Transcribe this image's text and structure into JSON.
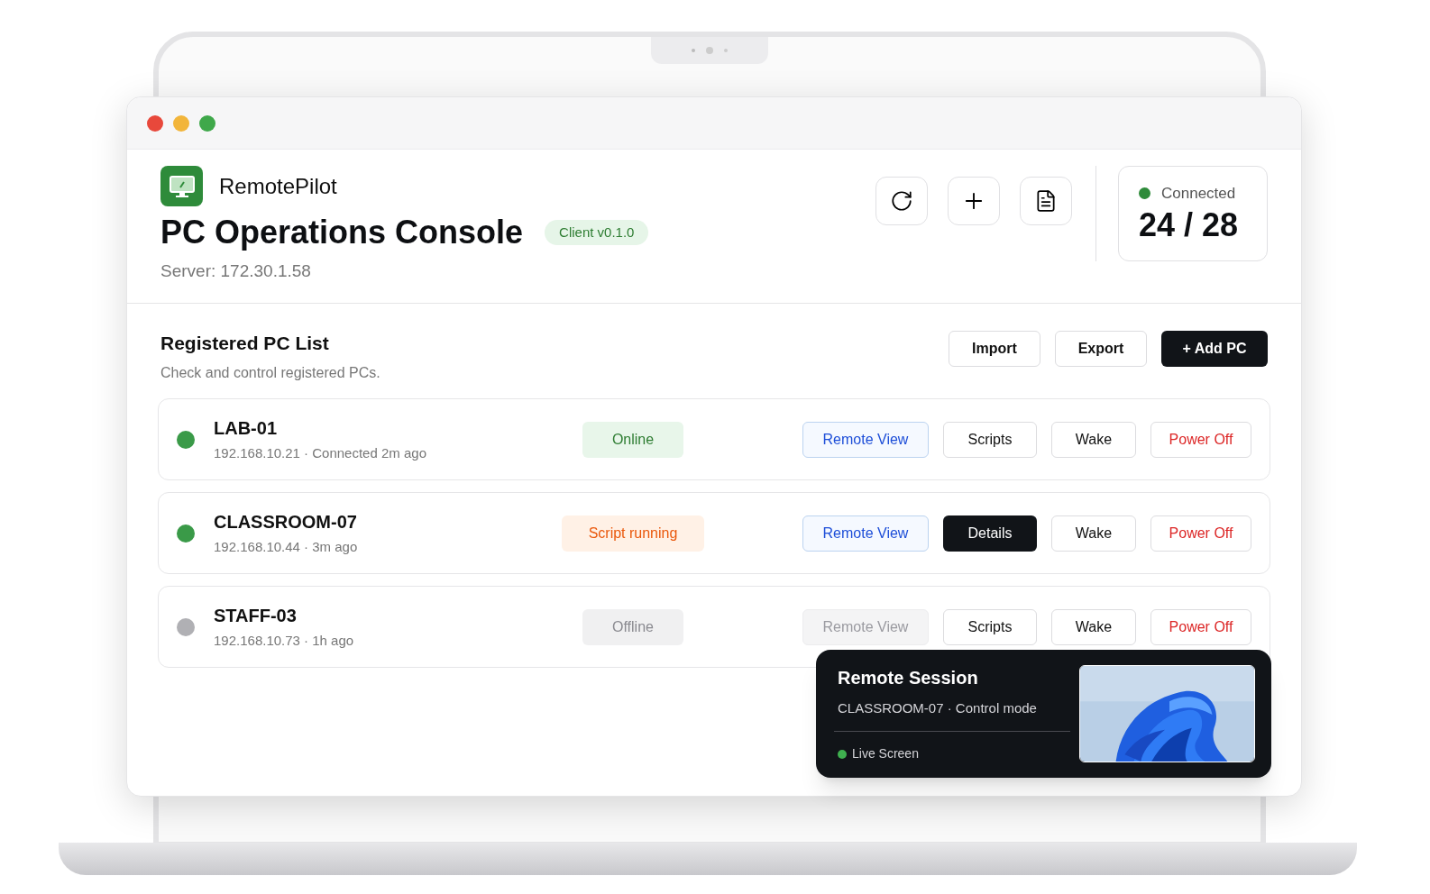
{
  "app": {
    "name": "RemotePilot",
    "title": "PC Operations Console",
    "version": "Client v0.1.0",
    "server": "Server: 172.30.1.58"
  },
  "connection": {
    "label": "Connected",
    "count": "24 / 28",
    "color": "#2e8b3a"
  },
  "list": {
    "title": "Registered PC List",
    "subtitle": "Check and control registered PCs.",
    "actions": [
      {
        "label": "Import",
        "kind": "outline"
      },
      {
        "label": "Export",
        "kind": "outline"
      },
      {
        "label": "+ Add PC",
        "kind": "dark"
      }
    ]
  },
  "pcs": [
    {
      "name": "LAB-01",
      "meta": "192.168.10.21 · Connected 2m ago",
      "color": "#3a9a48",
      "status": {
        "label": "Online",
        "kind": "online"
      },
      "buttons": [
        {
          "label": "Remote View",
          "kind": "primary",
          "disabled": false
        },
        {
          "label": "Scripts",
          "kind": "outline",
          "disabled": false
        },
        {
          "label": "Wake",
          "kind": "outline",
          "disabled": false
        },
        {
          "label": "Power Off",
          "kind": "danger",
          "disabled": false
        }
      ]
    },
    {
      "name": "CLASSROOM-07",
      "meta": "192.168.10.44 · 3m ago",
      "color": "#3a9a48",
      "status": {
        "label": "Script running",
        "kind": "running"
      },
      "buttons": [
        {
          "label": "Remote View",
          "kind": "primary",
          "disabled": false
        },
        {
          "label": "Details",
          "kind": "dark",
          "disabled": false
        },
        {
          "label": "Wake",
          "kind": "outline",
          "disabled": false
        },
        {
          "label": "Power Off",
          "kind": "danger",
          "disabled": false
        }
      ]
    },
    {
      "name": "STAFF-03",
      "meta": "192.168.10.73 · 1h ago",
      "color": "#b0b0b4",
      "status": {
        "label": "Offline",
        "kind": "offline"
      },
      "buttons": [
        {
          "label": "Remote View",
          "kind": "primary",
          "disabled": true
        },
        {
          "label": "Scripts",
          "kind": "outline",
          "disabled": false
        },
        {
          "label": "Wake",
          "kind": "outline",
          "disabled": false
        },
        {
          "label": "Power Off",
          "kind": "danger",
          "disabled": false
        }
      ]
    }
  ],
  "session": {
    "title": "Remote Session",
    "subtitle": "CLASSROOM-07 · Control mode",
    "live": {
      "label": "Live Screen",
      "color": "#3fb04f"
    }
  }
}
